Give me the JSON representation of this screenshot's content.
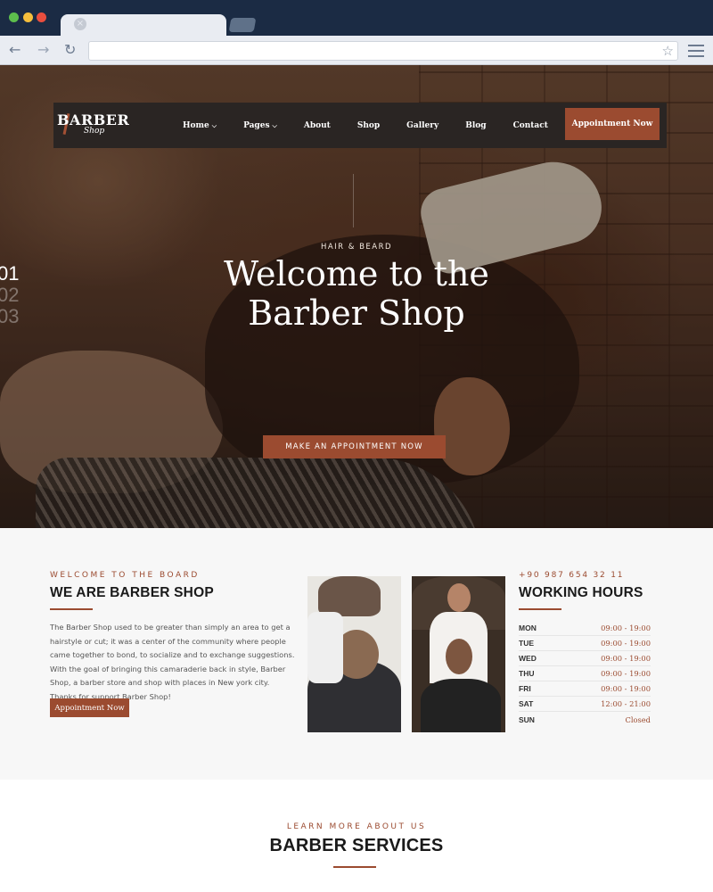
{
  "browser": {
    "tab_close": "×",
    "nav_back": "←",
    "nav_forward": "→",
    "nav_reload": "↻",
    "url_value": "",
    "bookmark_icon": "☆"
  },
  "navbar": {
    "logo_main": "BARBER",
    "logo_sub": "Shop",
    "menu": [
      {
        "label": "Home",
        "dropdown": "⌵"
      },
      {
        "label": "Pages",
        "dropdown": "⌵"
      },
      {
        "label": "About"
      },
      {
        "label": "Shop"
      },
      {
        "label": "Gallery"
      },
      {
        "label": "Blog"
      },
      {
        "label": "Contact"
      }
    ],
    "cta": "Appointment Now"
  },
  "hero": {
    "slides": [
      "01",
      "02",
      "03"
    ],
    "eyebrow": "HAIR & BEARD",
    "title_line1": "Welcome to the",
    "title_line2": "Barber Shop",
    "button": "MAKE AN APPOINTMENT NOW"
  },
  "about": {
    "eyebrow": "WELCOME TO THE BOARD",
    "title": "WE ARE BARBER SHOP",
    "text": "The Barber Shop used to be greater than simply an area to get a hairstyle or cut; it was a center of the community where people came together to bond, to socialize and to exchange suggestions. With the goal of bringing this camaraderie back in style, Barber Shop, a barber store and shop with places in New york city. Thanks for support Barber Shop!",
    "button": "Appointment Now"
  },
  "hours": {
    "phone": "+90 987 654 32 11",
    "title": "WORKING HOURS",
    "rows": [
      {
        "day": "MON",
        "time": "09:00 - 19:00"
      },
      {
        "day": "TUE",
        "time": "09:00 - 19:00"
      },
      {
        "day": "WED",
        "time": "09:00 - 19:00"
      },
      {
        "day": "THU",
        "time": "09:00 - 19:00"
      },
      {
        "day": "FRI",
        "time": "09:00 - 19:00"
      },
      {
        "day": "SAT",
        "time": "12:00 - 21:00"
      },
      {
        "day": "SUN",
        "time": "Closed"
      }
    ]
  },
  "services": {
    "eyebrow": "LEARN MORE ABOUT US",
    "title": "BARBER SERVICES"
  },
  "colors": {
    "accent": "#9b4b30",
    "chrome": "#1b2b44",
    "navbar": "#2a2523"
  }
}
